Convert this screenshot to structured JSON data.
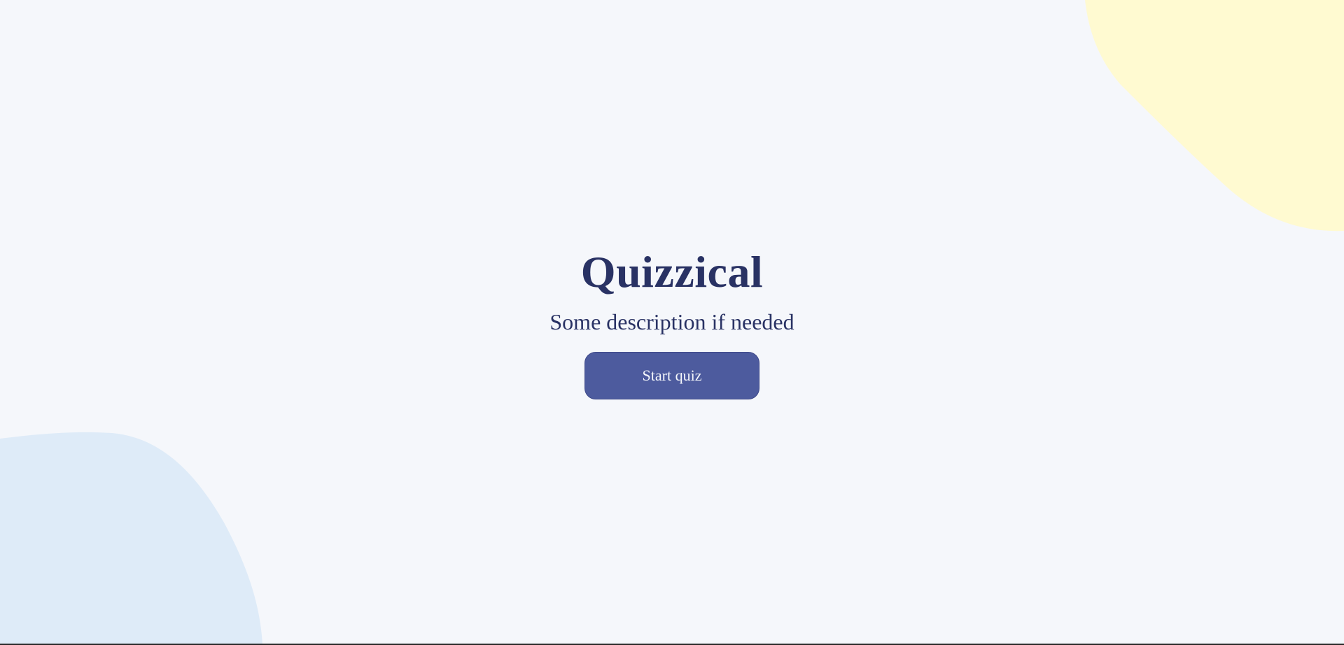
{
  "app": {
    "title": "Quizzical",
    "description": "Some description if needed"
  },
  "actions": {
    "start_label": "Start quiz"
  },
  "colors": {
    "background": "#F5F7FB",
    "text": "#293264",
    "button": "#4D5B9E",
    "button_text": "#F5F7FB",
    "blob_yellow": "#FFFAD1",
    "blob_blue": "#DEEBF8"
  }
}
